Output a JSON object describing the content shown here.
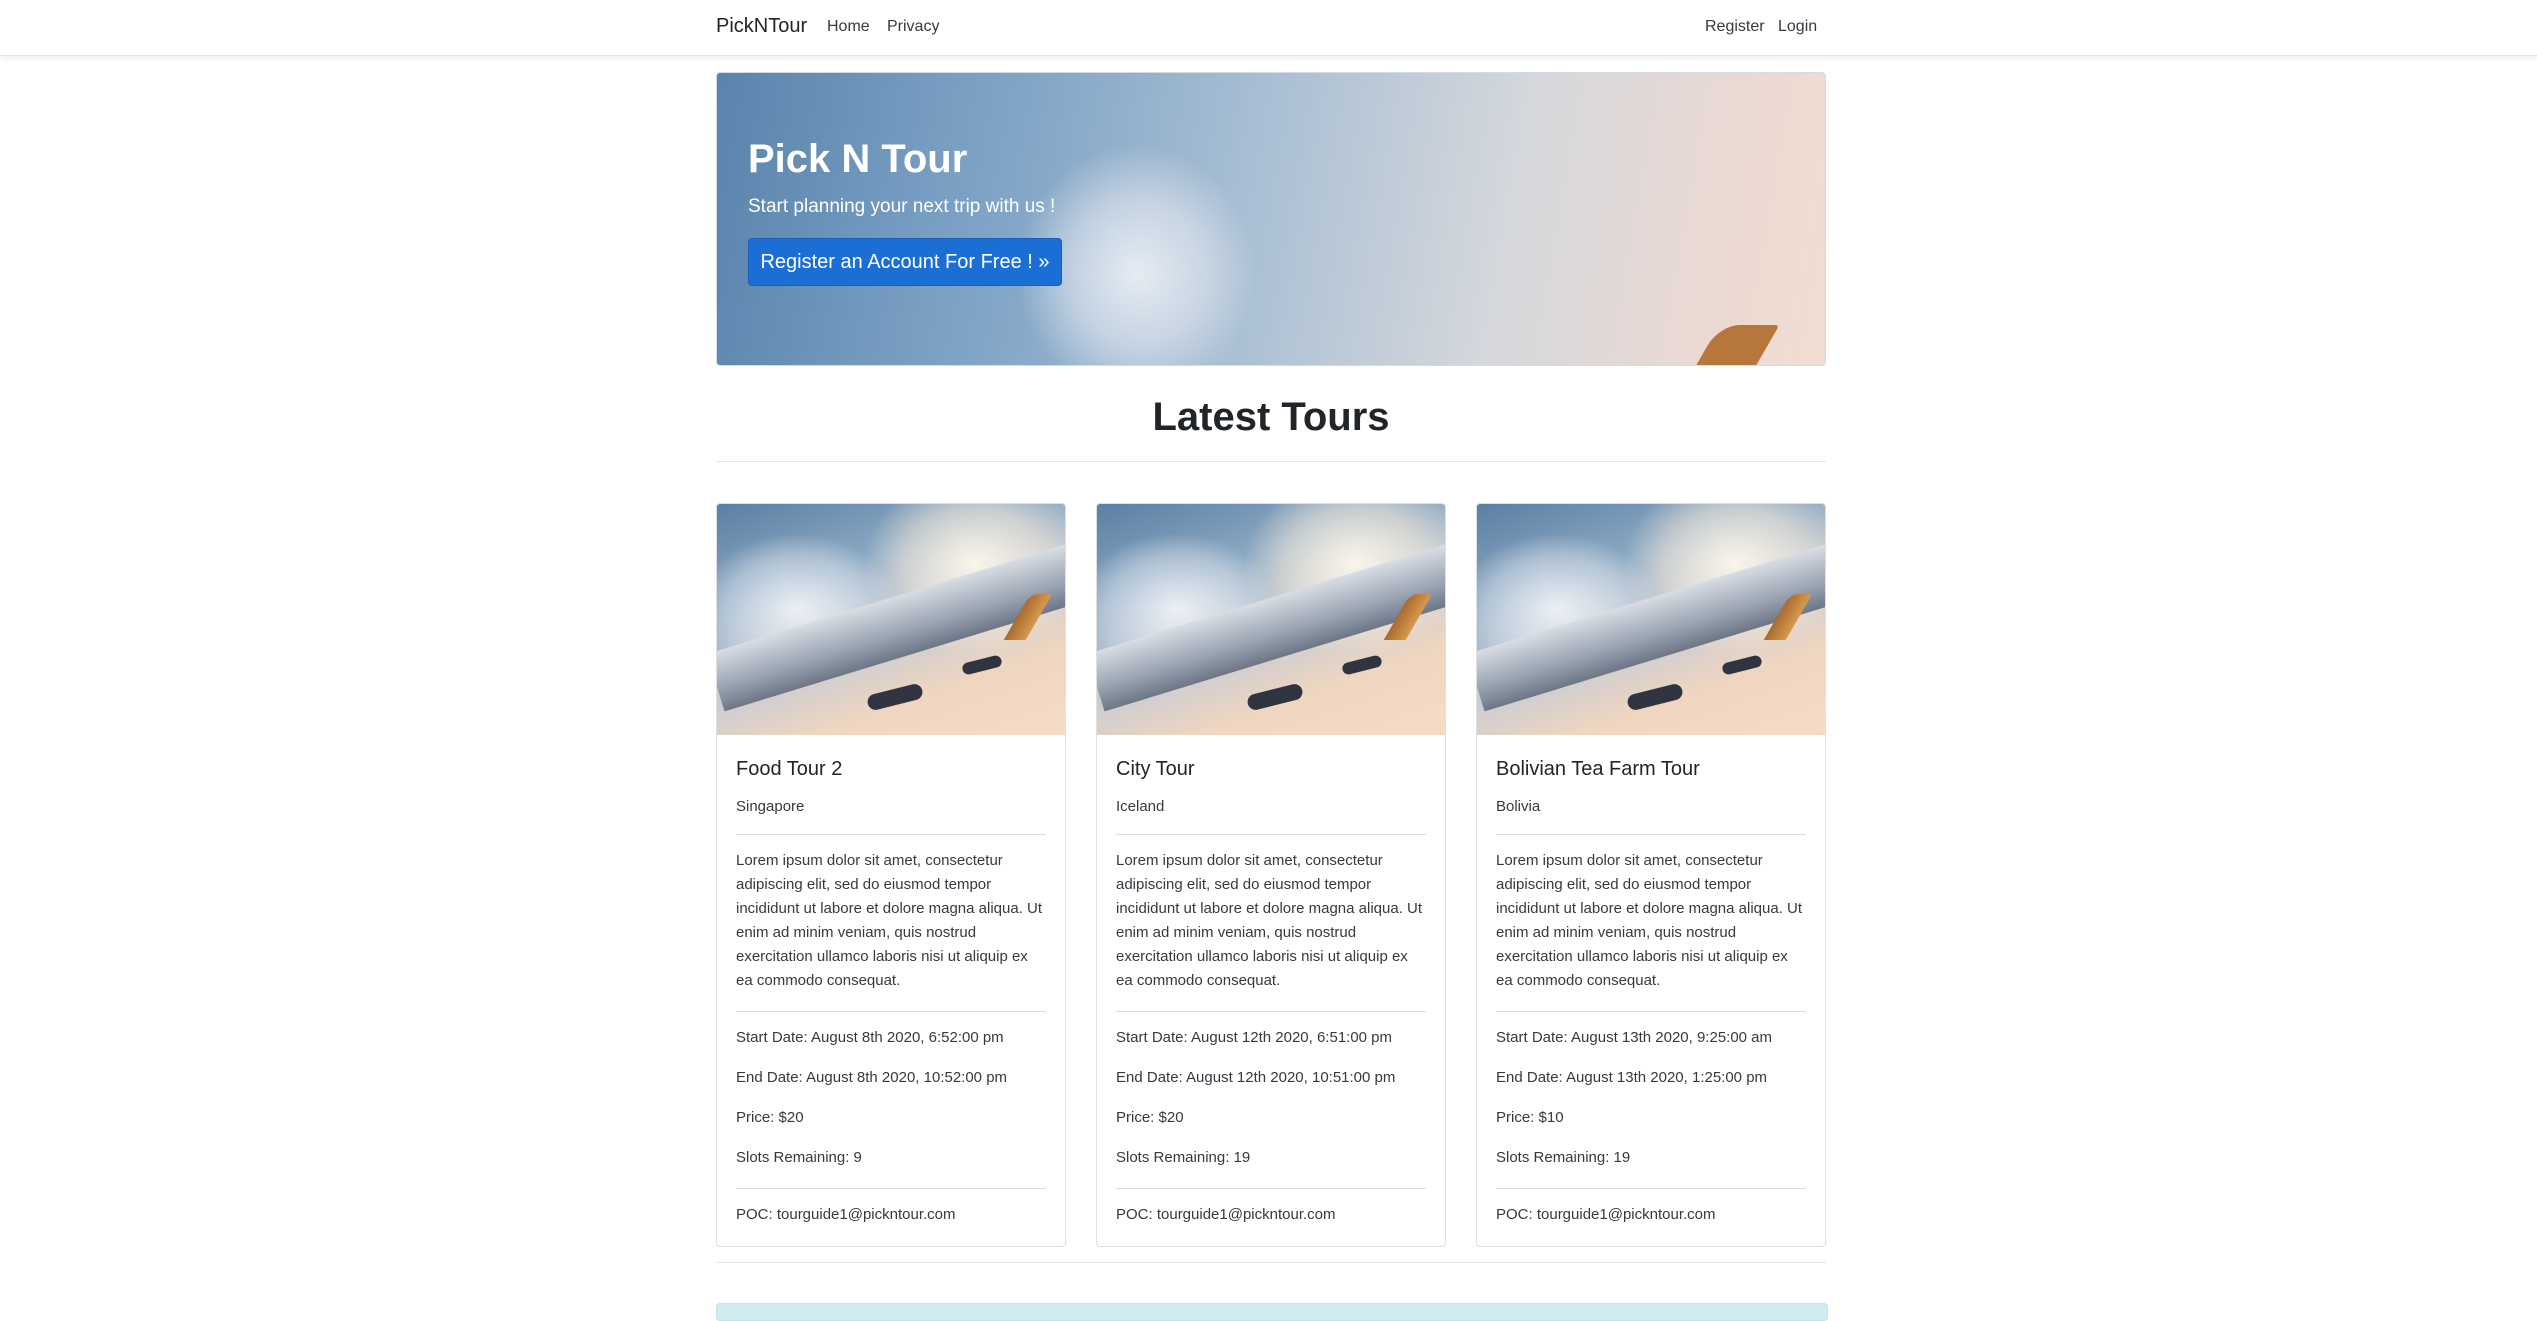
{
  "navbar": {
    "brand": "PickNTour",
    "links": [
      "Home",
      "Privacy"
    ],
    "right_links": [
      "Register",
      "Login"
    ]
  },
  "hero": {
    "title": "Pick N Tour",
    "subtitle": "Start planning your next trip with us !",
    "button_label": "Register an Account For Free ! »"
  },
  "section": {
    "title": "Latest Tours"
  },
  "tours": [
    {
      "title": "Food Tour 2",
      "location": "Singapore",
      "description": "Lorem ipsum dolor sit amet, consectetur adipiscing elit, sed do eiusmod tempor incididunt ut labore et dolore magna aliqua. Ut enim ad minim veniam, quis nostrud exercitation ullamco laboris nisi ut aliquip ex ea commodo consequat.",
      "start": "Start Date: August 8th 2020, 6:52:00 pm",
      "end": "End Date: August 8th 2020, 10:52:00 pm",
      "price": "Price: $20",
      "slots": "Slots Remaining: 9",
      "poc": "POC: tourguide1@pickntour.com"
    },
    {
      "title": "City Tour",
      "location": "Iceland",
      "description": "Lorem ipsum dolor sit amet, consectetur adipiscing elit, sed do eiusmod tempor incididunt ut labore et dolore magna aliqua. Ut enim ad minim veniam, quis nostrud exercitation ullamco laboris nisi ut aliquip ex ea commodo consequat.",
      "start": "Start Date: August 12th 2020, 6:51:00 pm",
      "end": "End Date: August 12th 2020, 10:51:00 pm",
      "price": "Price: $20",
      "slots": "Slots Remaining: 19",
      "poc": "POC: tourguide1@pickntour.com"
    },
    {
      "title": "Bolivian Tea Farm Tour",
      "location": "Bolivia",
      "description": "Lorem ipsum dolor sit amet, consectetur adipiscing elit, sed do eiusmod tempor incididunt ut labore et dolore magna aliqua. Ut enim ad minim veniam, quis nostrud exercitation ullamco laboris nisi ut aliquip ex ea commodo consequat.",
      "start": "Start Date: August 13th 2020, 9:25:00 am",
      "end": "End Date: August 13th 2020, 1:25:00 pm",
      "price": "Price: $10",
      "slots": "Slots Remaining: 19",
      "poc": "POC: tourguide1@pickntour.com"
    }
  ]
}
